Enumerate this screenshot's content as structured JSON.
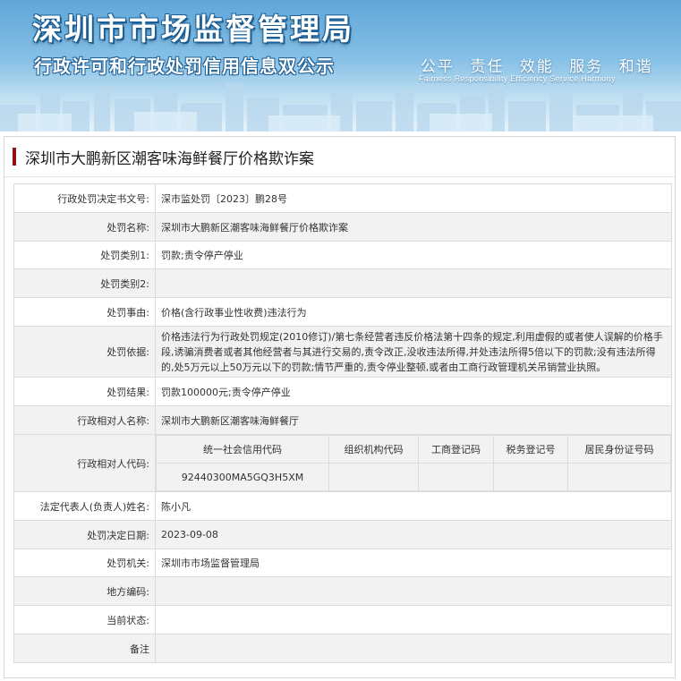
{
  "header": {
    "title": "深圳市市场监督管理局",
    "subtitle": "行政许可和行政处罚信用信息双公示",
    "motto": [
      "公平",
      "责任",
      "效能",
      "服务",
      "和谐"
    ],
    "motto_en": "Fairness Responsibility Efficiency Service Harmony"
  },
  "panel": {
    "title": "深圳市大鹏新区潮客味海鲜餐厅价格欺诈案"
  },
  "fields": {
    "decision_no": {
      "label": "行政处罚决定书文号:",
      "value": "深市监处罚〔2023〕鹏28号"
    },
    "case_name": {
      "label": "处罚名称:",
      "value": "深圳市大鹏新区潮客味海鲜餐厅价格欺诈案"
    },
    "category1": {
      "label": "处罚类别1:",
      "value": "罚款;责令停产停业"
    },
    "category2": {
      "label": "处罚类别2:",
      "value": ""
    },
    "reason": {
      "label": "处罚事由:",
      "value": "价格(含行政事业性收费)违法行为"
    },
    "basis": {
      "label": "处罚依据:",
      "value": "价格违法行为行政处罚规定(2010修订)/第七条经营者违反价格法第十四条的规定,利用虚假的或者使人误解的价格手段,诱骗消费者或者其他经营者与其进行交易的,责令改正,没收违法所得,并处违法所得5倍以下的罚款;没有违法所得的,处5万元以上50万元以下的罚款;情节严重的,责令停业整顿,或者由工商行政管理机关吊销营业执照。"
    },
    "result": {
      "label": "处罚结果:",
      "value": "罚款100000元;责令停产停业"
    },
    "party_name": {
      "label": "行政相对人名称:",
      "value": "深圳市大鹏新区潮客味海鲜餐厅"
    },
    "party_code": {
      "label": "行政相对人代码:",
      "headers": [
        "统一社会信用代码",
        "组织机构代码",
        "工商登记码",
        "税务登记号",
        "居民身份证号码"
      ],
      "values": [
        "92440300MA5GQ3H5XM",
        "",
        "",
        "",
        ""
      ]
    },
    "legal_rep": {
      "label": "法定代表人(负责人)姓名:",
      "value": "陈小凡"
    },
    "decision_date": {
      "label": "处罚决定日期:",
      "value": "2023-09-08"
    },
    "authority": {
      "label": "处罚机关:",
      "value": "深圳市市场监督管理局"
    },
    "region_code": {
      "label": "地方编码:",
      "value": ""
    },
    "status": {
      "label": "当前状态:",
      "value": ""
    },
    "remark": {
      "label": "备注",
      "value": ""
    }
  }
}
